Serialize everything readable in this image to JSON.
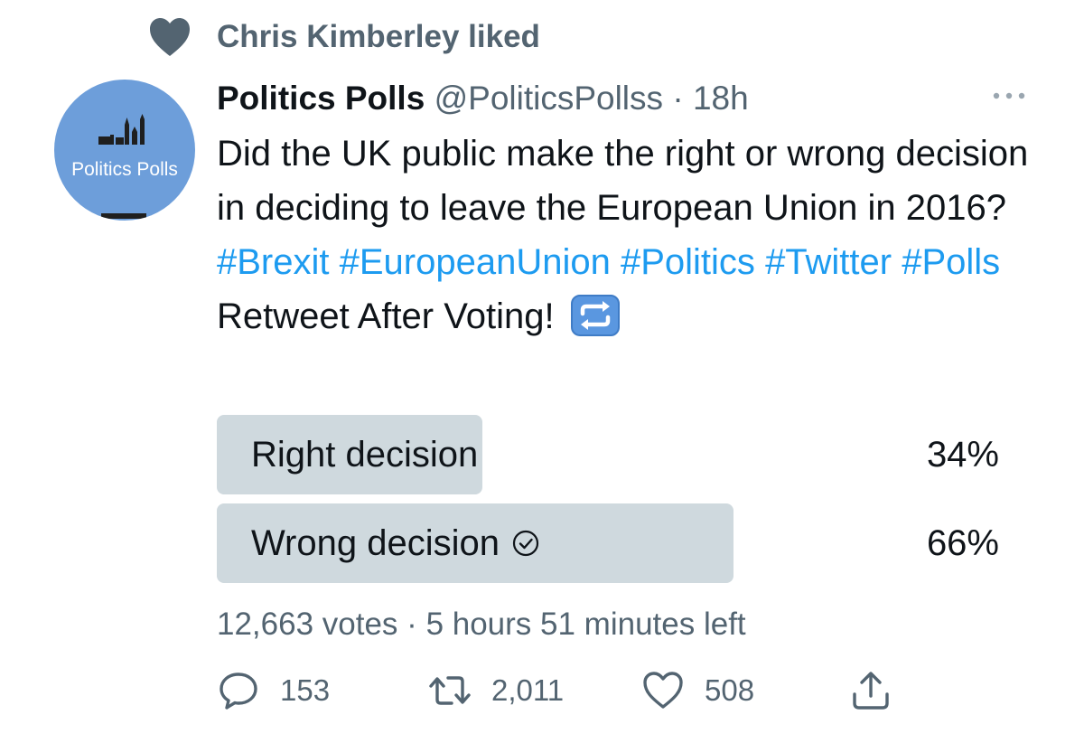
{
  "social_context": {
    "icon": "heart-icon",
    "text": "Chris Kimberley liked"
  },
  "author": {
    "avatar_text": "Politics Polls",
    "name": "Politics Polls",
    "handle": "@PoliticsPollss",
    "separator": "·",
    "time": "18h"
  },
  "tweet": {
    "text_before": "Did the UK public make the right or wrong decision in deciding to leave the European Union in 2016? ",
    "hashtags": [
      "#Brexit",
      "#EuropeanUnion",
      "#Politics",
      "#Twitter",
      "#Polls"
    ],
    "text_after": " Retweet After Voting! ",
    "emoji": "retweet-emoji"
  },
  "poll": {
    "options": [
      {
        "label": "Right decision",
        "percent_text": "34%",
        "fraction": 0.34,
        "selected": false
      },
      {
        "label": "Wrong decision",
        "percent_text": "66%",
        "fraction": 0.66,
        "selected": true
      }
    ],
    "votes": "12,663 votes",
    "separator": "·",
    "time_left": "5 hours 51 minutes left"
  },
  "actions": {
    "replies": "153",
    "retweets": "2,011",
    "likes": "508"
  },
  "colors": {
    "link": "#1d9bf0",
    "secondary_text": "#536471",
    "poll_bar": "#cfd9de",
    "avatar_bg": "#6d9eda"
  }
}
